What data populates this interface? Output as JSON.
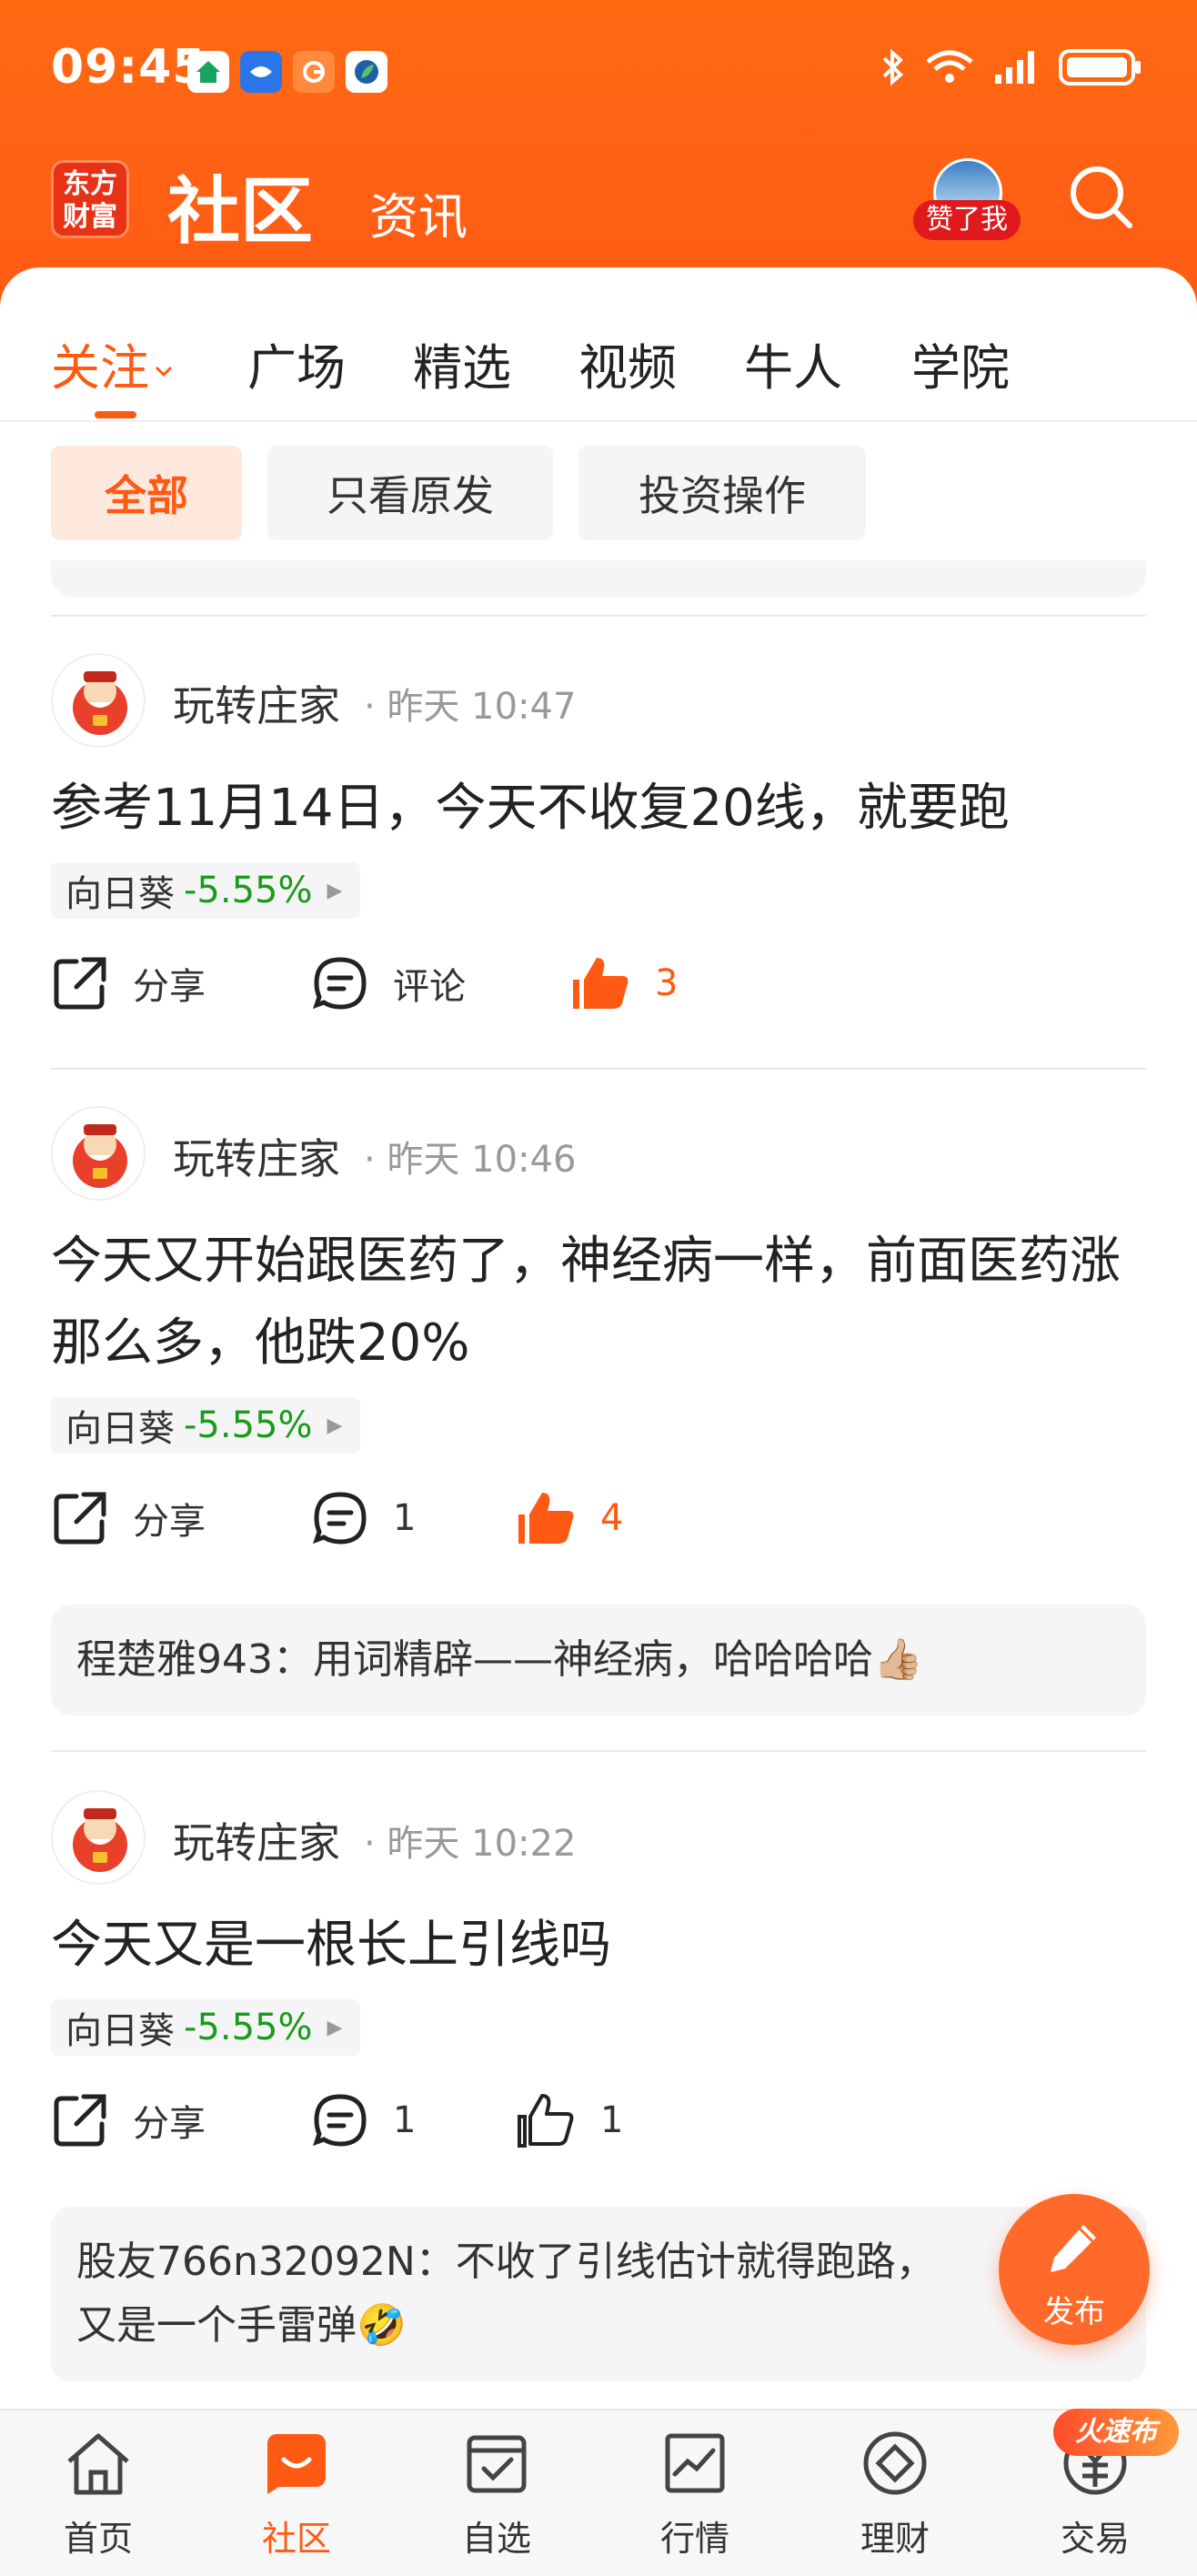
{
  "status_bar": {
    "time": "09:45",
    "app_icons": [
      "home-app-icon",
      "fish-app-icon",
      "g-app-icon",
      "leaf-app-icon"
    ],
    "battery": "full"
  },
  "header": {
    "logo_line1": "东方",
    "logo_line2": "财富",
    "title": "社区",
    "subtitle": "资讯",
    "liked_badge": "赞了我"
  },
  "tabs": [
    {
      "label": "关注",
      "active": true
    },
    {
      "label": "广场"
    },
    {
      "label": "精选"
    },
    {
      "label": "视频"
    },
    {
      "label": "牛人"
    },
    {
      "label": "学院"
    }
  ],
  "filters": [
    {
      "label": "全部",
      "active": true
    },
    {
      "label": "只看原发"
    },
    {
      "label": "投资操作"
    }
  ],
  "posts": [
    {
      "author": "玩转庄家",
      "time": "· 昨天 10:47",
      "content": "参考11月14日，今天不收复20线，就要跑",
      "stock": {
        "name": "向日葵",
        "change": "-5.55%"
      },
      "share_label": "分享",
      "comment_label": "评论",
      "like_count": "3",
      "liked": true
    },
    {
      "author": "玩转庄家",
      "time": "· 昨天 10:46",
      "content": "今天又开始跟医药了，神经病一样，前面医药涨那么多，他跌20%",
      "stock": {
        "name": "向日葵",
        "change": "-5.55%"
      },
      "share_label": "分享",
      "comment_label": "1",
      "like_count": "4",
      "liked": true,
      "comment": {
        "user": "程楚雅943",
        "text": "：用词精辟——神经病，哈哈哈哈👍🏼"
      }
    },
    {
      "author": "玩转庄家",
      "time": "· 昨天 10:22",
      "content": "今天又是一根长上引线吗",
      "stock": {
        "name": "向日葵",
        "change": "-5.55%"
      },
      "share_label": "分享",
      "comment_label": "1",
      "like_count": "1",
      "liked": false,
      "comment": {
        "user": "股友766n32092N",
        "text": "：不收了引线估计就得跑路，又是一个手雷弹🤣"
      }
    }
  ],
  "fab": {
    "label": "发布"
  },
  "bottom_nav": [
    {
      "label": "首页",
      "icon": "home-icon"
    },
    {
      "label": "社区",
      "icon": "community-icon",
      "active": true
    },
    {
      "label": "自选",
      "icon": "watchlist-icon"
    },
    {
      "label": "行情",
      "icon": "market-icon"
    },
    {
      "label": "理财",
      "icon": "wealth-icon"
    },
    {
      "label": "交易",
      "icon": "trade-icon"
    }
  ],
  "promo_badge": "火速布",
  "colors": {
    "brand": "#ff5a14",
    "down": "#1a9b1a",
    "liked_badge": "#e0191c"
  }
}
